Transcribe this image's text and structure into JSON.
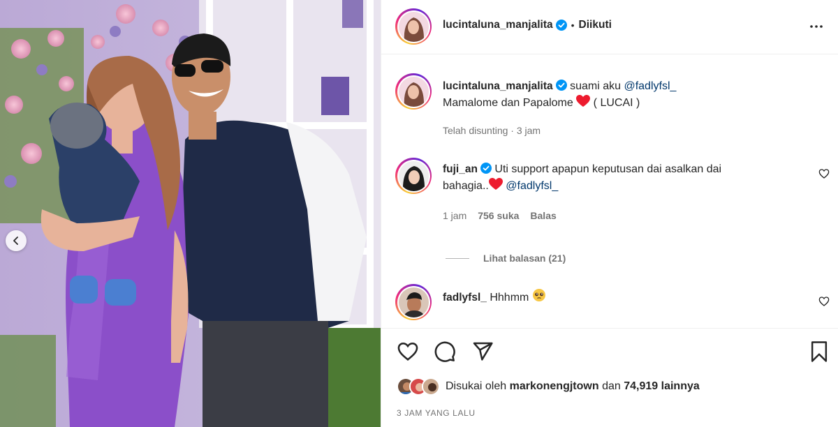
{
  "post": {
    "author": "lucintaluna_manjalita",
    "follow_status": "Diikuti",
    "dot": "•"
  },
  "caption": {
    "username": "lucintaluna_manjalita",
    "text_before": "suami aku",
    "mention": "@fadlyfsl_",
    "line2_before": "Mamalome dan Papalome",
    "line2_after": "( LUCAI )",
    "meta": "Telah disunting · 3 jam"
  },
  "comments": [
    {
      "username": "fuji_an",
      "text_line1": "Uti support apapun keputusan dai asalkan dai",
      "text_line2": "bahagia..",
      "mention": "@fadlyfsl_",
      "time": "1 jam",
      "likes": "756 suka",
      "reply": "Balas",
      "view_replies": "Lihat balasan (21)"
    },
    {
      "username": "fadlyfsl_",
      "text": "Hhhmm"
    }
  ],
  "likes": {
    "prefix": "Disukai oleh",
    "user": "markonengjtown",
    "middle": "dan",
    "count": "74,919",
    "suffix": "lainnya"
  },
  "timestamp": "3 JAM YANG LALU",
  "icons": [
    "verified-icon",
    "more-options-icon",
    "heart-icon",
    "comment-icon",
    "share-icon",
    "bookmark-icon",
    "chevron-left-icon"
  ],
  "colors": {
    "accent_link": "#00376b",
    "verified": "#0095f6",
    "heart_red": "#ed1b2e",
    "secondary_text": "#737373",
    "border": "#efefef"
  }
}
